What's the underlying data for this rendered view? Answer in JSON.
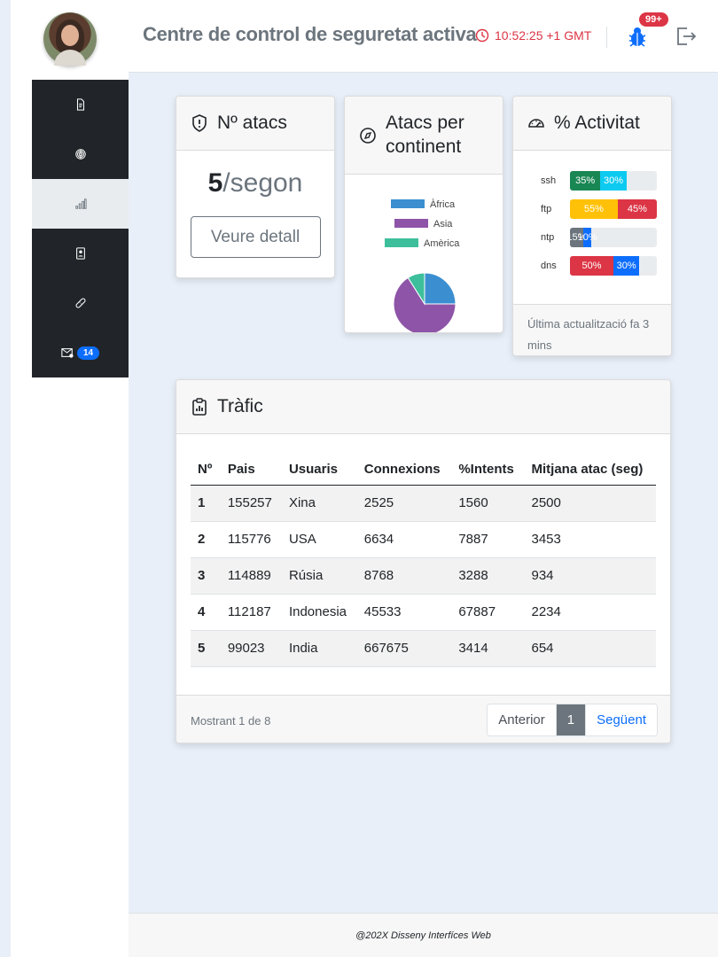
{
  "header": {
    "title": "Centre de control de seguretat activa",
    "time": "10:52:25 +1 GMT",
    "notif_badge": "99+"
  },
  "sidebar": {
    "items": [
      {
        "icon": "document-icon"
      },
      {
        "icon": "fingerprint-icon"
      },
      {
        "icon": "bar-signal-icon",
        "active": true
      },
      {
        "icon": "contact-card-icon"
      },
      {
        "icon": "bandage-icon"
      },
      {
        "icon": "mail-icon",
        "badge": "14"
      }
    ]
  },
  "attacks": {
    "title": "Nº atacs",
    "value": "5",
    "unit": "/segon",
    "button": "Veure detall"
  },
  "continent": {
    "title": "Atacs per continent",
    "chart_data": {
      "type": "pie",
      "categories": [
        "Àfrica",
        "Asia",
        "Amèrica"
      ],
      "values": [
        25,
        66,
        9
      ],
      "colors": [
        "#3b8fd0",
        "#8e54a8",
        "#3dbf9b"
      ],
      "legend": "top"
    }
  },
  "activity": {
    "title": "% Activitat",
    "rows": [
      {
        "label": "ssh",
        "segments": [
          {
            "text": "35%",
            "value": 35,
            "color": "#198754"
          },
          {
            "text": "30%",
            "value": 30,
            "color": "#0dcaf0"
          }
        ]
      },
      {
        "label": "ftp",
        "segments": [
          {
            "text": "55%",
            "value": 55,
            "color": "#ffc107"
          },
          {
            "text": "45%",
            "value": 45,
            "color": "#dc3545"
          }
        ]
      },
      {
        "label": "ntp",
        "segments": [
          {
            "text": "15%",
            "value": 15,
            "color": "#6c757d"
          },
          {
            "text": "10%",
            "value": 10,
            "color": "#0d6efd"
          }
        ]
      },
      {
        "label": "dns",
        "segments": [
          {
            "text": "50%",
            "value": 50,
            "color": "#dc3545"
          },
          {
            "text": "30%",
            "value": 30,
            "color": "#0d6efd"
          }
        ]
      }
    ],
    "footer": "Última actualització fa 3 mins"
  },
  "traffic": {
    "title": "Tràfic",
    "columns": [
      "Nº",
      "Pais",
      "Usuaris",
      "Connexions",
      "%Intents",
      "Mitjana atac (seg)"
    ],
    "rows": [
      [
        "1",
        "155257",
        "Xina",
        "2525",
        "1560",
        "2500"
      ],
      [
        "2",
        "115776",
        "USA",
        "6634",
        "7887",
        "3453"
      ],
      [
        "3",
        "114889",
        "Rúsia",
        "8768",
        "3288",
        "934"
      ],
      [
        "4",
        "112187",
        "Indonesia",
        "45533",
        "67887",
        "2234"
      ],
      [
        "5",
        "99023",
        "India",
        "667675",
        "3414",
        "654"
      ]
    ],
    "showing": "Mostrant 1 de 8",
    "pagination": {
      "prev": "Anterior",
      "current": "1",
      "next": "Següent"
    }
  },
  "footer": {
    "text": "@202X Disseny Interfíces Web"
  }
}
